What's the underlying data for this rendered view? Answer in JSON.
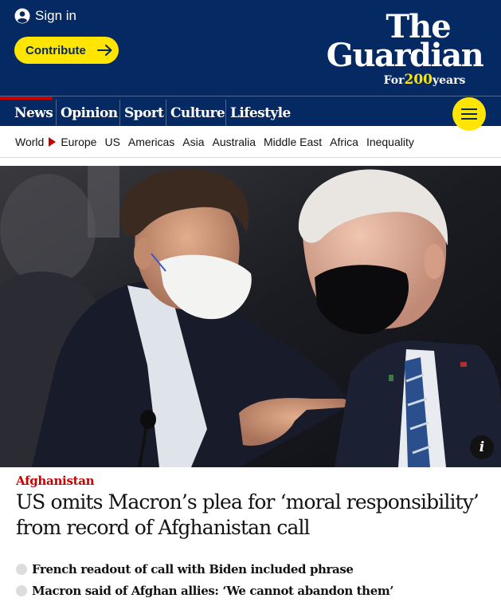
{
  "header": {
    "sign_in_label": "Sign in",
    "contribute_label": "Contribute",
    "logo_the": "The",
    "logo_guardian": "Guardian",
    "logo_for": "For",
    "logo_years_number": "200",
    "logo_years": "years",
    "colors": {
      "background": "#052962",
      "accent": "#ffe500",
      "highlight": "#c70000"
    }
  },
  "pillars": [
    {
      "label": "News",
      "active": true
    },
    {
      "label": "Opinion",
      "active": false
    },
    {
      "label": "Sport",
      "active": false
    },
    {
      "label": "Culture",
      "active": false
    },
    {
      "label": "Lifestyle",
      "active": false
    }
  ],
  "menu_icon": "hamburger-icon",
  "subnav": [
    "World",
    "Europe",
    "US",
    "Americas",
    "Asia",
    "Australia",
    "Middle East",
    "Africa",
    "Inequality"
  ],
  "hero": {
    "info_label": "i"
  },
  "article": {
    "kicker": "Afghanistan",
    "headline": "US omits Macron’s plea for ‘moral responsibility’ from record of Afghanistan call",
    "bullets": [
      "French readout of call with Biden included phrase",
      "Macron said of Afghan allies: ‘We cannot abandon them’"
    ]
  }
}
